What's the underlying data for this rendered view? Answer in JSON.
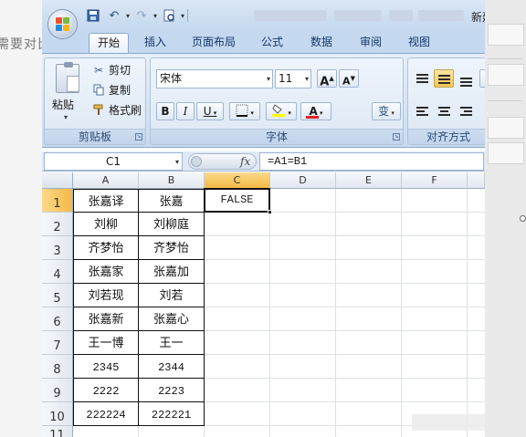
{
  "page": {
    "left_text": "需要对比"
  },
  "window": {
    "title": "新建"
  },
  "qat": {
    "undo_icon": "↶",
    "redo_icon": "↷"
  },
  "tabs": [
    {
      "label": "开始",
      "active": true
    },
    {
      "label": "插入"
    },
    {
      "label": "页面布局"
    },
    {
      "label": "公式"
    },
    {
      "label": "数据"
    },
    {
      "label": "审阅"
    },
    {
      "label": "视图"
    }
  ],
  "ribbon": {
    "clipboard": {
      "paste": "粘贴",
      "cut": "剪切",
      "copy": "复制",
      "format_painter": "格式刷",
      "group": "剪贴板"
    },
    "font": {
      "name": "宋体",
      "size": "11",
      "grow": "A",
      "shrink": "A",
      "bold": "B",
      "italic": "I",
      "underline": "U",
      "font_color_letter": "A",
      "phonetic": "变",
      "group": "字体"
    },
    "alignment": {
      "group": "对齐方式"
    }
  },
  "formula_bar": {
    "name_box": "C1",
    "fx": "fx",
    "formula": "=A1=B1"
  },
  "columns": [
    "A",
    "B",
    "C",
    "D",
    "E",
    "F"
  ],
  "rows": [
    "1",
    "2",
    "3",
    "4",
    "5",
    "6",
    "7",
    "8",
    "9",
    "10",
    "11"
  ],
  "cells": {
    "A": [
      "张嘉译",
      "刘柳",
      "齐梦怡",
      "张嘉家",
      "刘若现",
      "张嘉新",
      "王一博",
      "2345",
      "2222",
      "222224"
    ],
    "B": [
      "张嘉",
      "刘柳庭",
      "齐梦怡",
      "张嘉加",
      "刘若",
      "张嘉心",
      "王一",
      "2344",
      "2223",
      "222221"
    ],
    "C1": "FALSE"
  },
  "colors": {
    "accent": "#f4b947",
    "ribbon": "#d3e1f2"
  }
}
